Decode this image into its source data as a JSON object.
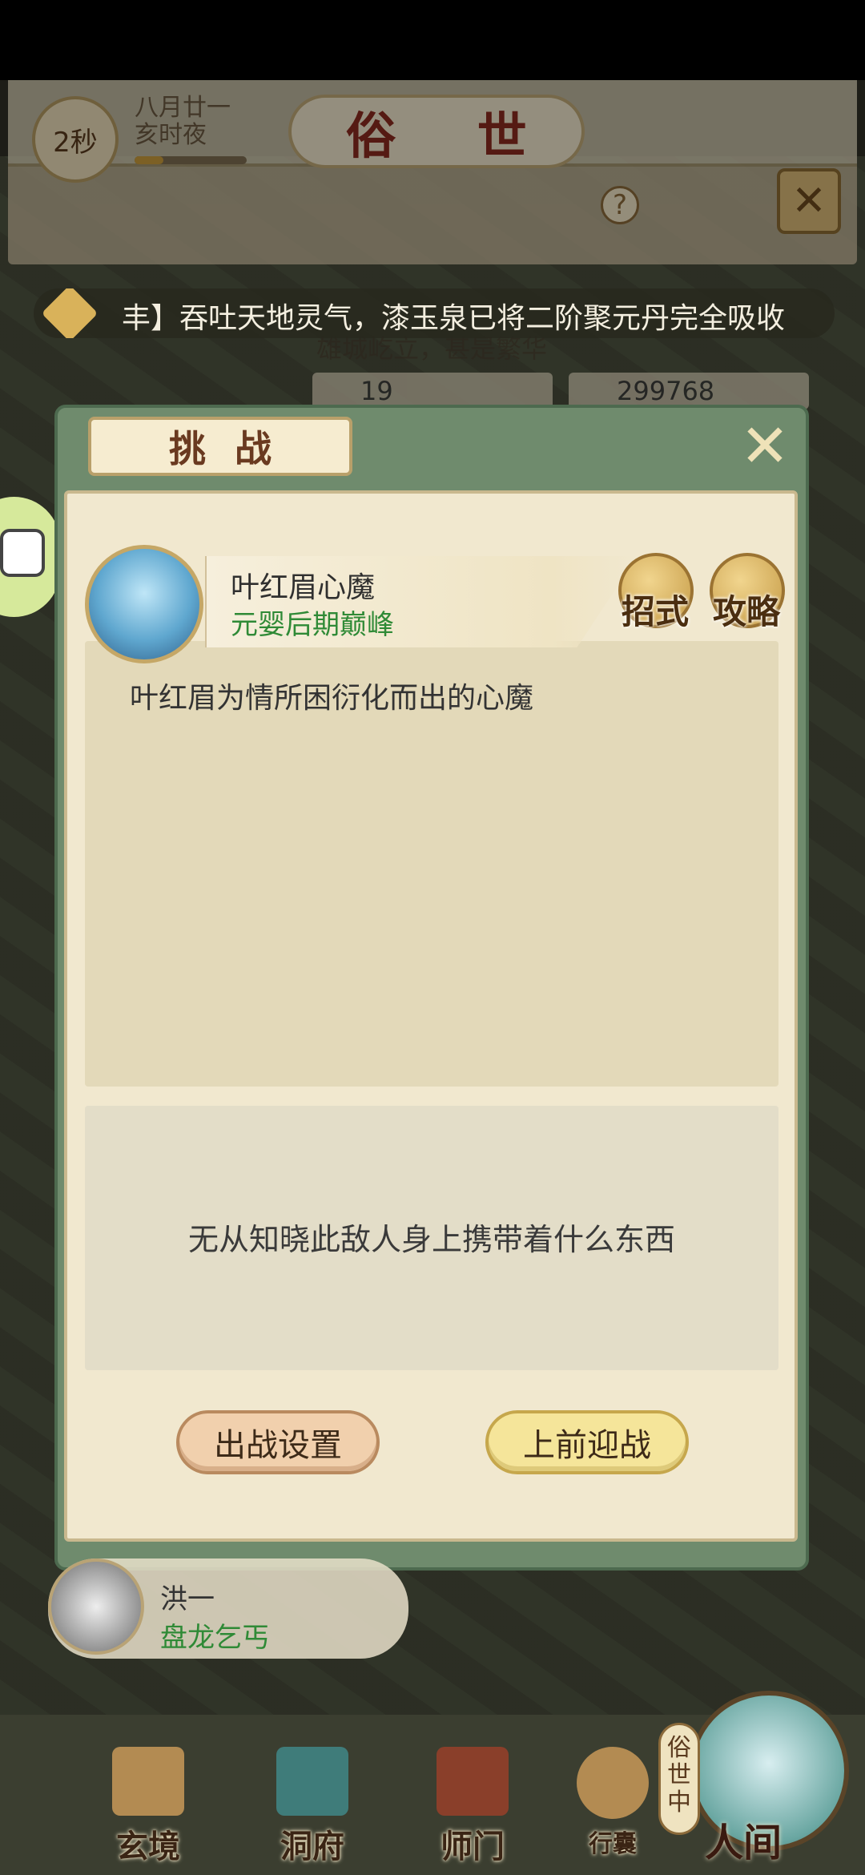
{
  "header": {
    "timer": "2秒",
    "date_line1": "八月廿一",
    "date_line2": "亥时夜",
    "title": "俗 世",
    "help": "?",
    "close": "✕"
  },
  "marquee": {
    "text": "丰】吞吐天地灵气，漆玉泉已将二阶聚元丹完全吸收"
  },
  "background": {
    "info_text": "雄城屹立，甚是繁华",
    "resource_a": "19",
    "resource_b": "299768"
  },
  "panel": {
    "tab_title": "挑战",
    "close": "✕",
    "enemy": {
      "name": "叶红眉心魔",
      "rank": "元婴后期巅峰"
    },
    "skills_button": "招式",
    "guide_button": "攻略",
    "description": "叶红眉为情所困衍化而出的心魔",
    "drops_text": "无从知晓此敌人身上携带着什么东西",
    "settings_button": "出战设置",
    "fight_button": "上前迎战"
  },
  "npc": {
    "name": "洪一",
    "title": "盘龙乞丐"
  },
  "bottom_nav": {
    "items": [
      {
        "label": "玄境"
      },
      {
        "label": "洞府"
      },
      {
        "label": "师门"
      },
      {
        "label": "行囊"
      }
    ],
    "vertical_tag": "俗世中",
    "current": "人间"
  }
}
